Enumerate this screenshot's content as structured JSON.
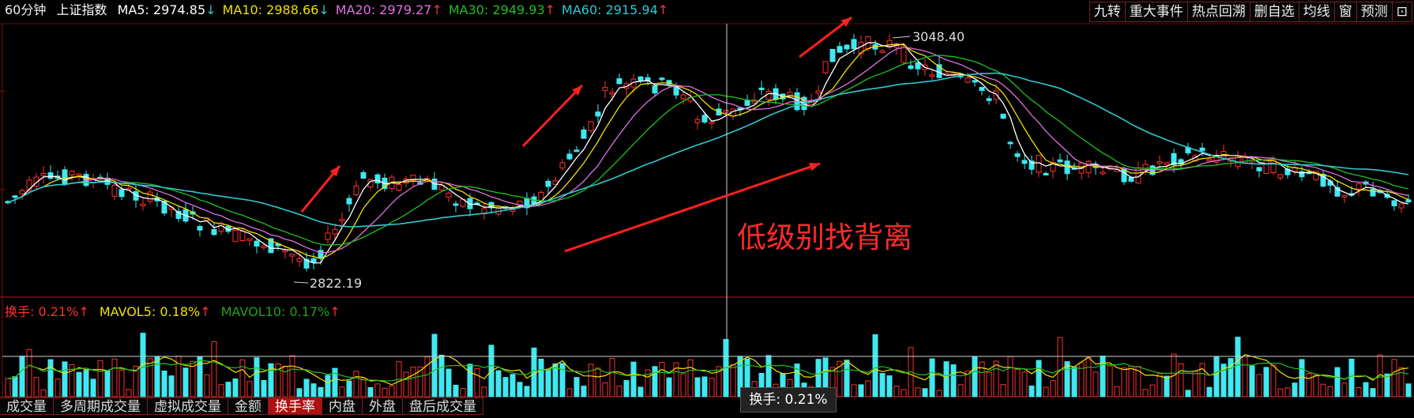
{
  "header": {
    "period": "60分钟",
    "symbol": "上证指数",
    "ma": [
      {
        "label": "MA5: 2974.85",
        "arrow": "↓",
        "color": "#ffffff"
      },
      {
        "label": "MA10: 2988.66",
        "arrow": "↓",
        "color": "#f0e000"
      },
      {
        "label": "MA20: 2979.27",
        "arrow": "↑",
        "color": "#e070e0"
      },
      {
        "label": "MA30: 2949.93",
        "arrow": "↑",
        "color": "#20c020"
      },
      {
        "label": "MA60: 2915.94",
        "arrow": "↑",
        "color": "#30c8d0"
      }
    ]
  },
  "toolbar": [
    "九转",
    "重大事件",
    "热点回溯",
    "删自选",
    "均线",
    "窗",
    "预测",
    "⊡"
  ],
  "chart_data": {
    "type": "candlestick",
    "high_label": "3048.40",
    "low_label": "2822.19",
    "annotation": "低级别找背离",
    "price_range": [
      2800,
      3060
    ],
    "volume_header": {
      "turnover": "换手: 0.21%",
      "mavol5": "MAVOL5: 0.18%",
      "mavol10": "MAVOL10: 0.17%"
    },
    "tooltip": "换手: 0.21%"
  },
  "bottom_tabs": [
    "成交量",
    "多周期成交量",
    "虚拟成交量",
    "金额",
    "换手率",
    "内盘",
    "外盘",
    "盘后成交量"
  ],
  "active_tab": "换手率"
}
